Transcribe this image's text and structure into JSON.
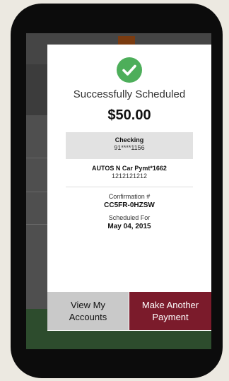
{
  "modal": {
    "title": "Successfully Scheduled",
    "amount": "$50.00",
    "from_account": {
      "name": "Checking",
      "number": "91****1156"
    },
    "to_payee": {
      "name": "AUTOS N Car Pymt*1662",
      "number": "1212121212"
    },
    "confirmation_label": "Confirmation #",
    "confirmation_value": "CC5FR-0HZSW",
    "scheduled_label": "Scheduled For",
    "scheduled_value": "May 04, 2015",
    "buttons": {
      "view_accounts": {
        "line1": "View My",
        "line2": "Accounts"
      },
      "make_payment": {
        "line1": "Make Another",
        "line2": "Payment"
      }
    }
  },
  "colors": {
    "success_green": "#4dae5a",
    "primary_button": "#7b1b2b",
    "secondary_button": "#c9c9c9"
  },
  "icons": {
    "status": "check-circle-icon"
  }
}
